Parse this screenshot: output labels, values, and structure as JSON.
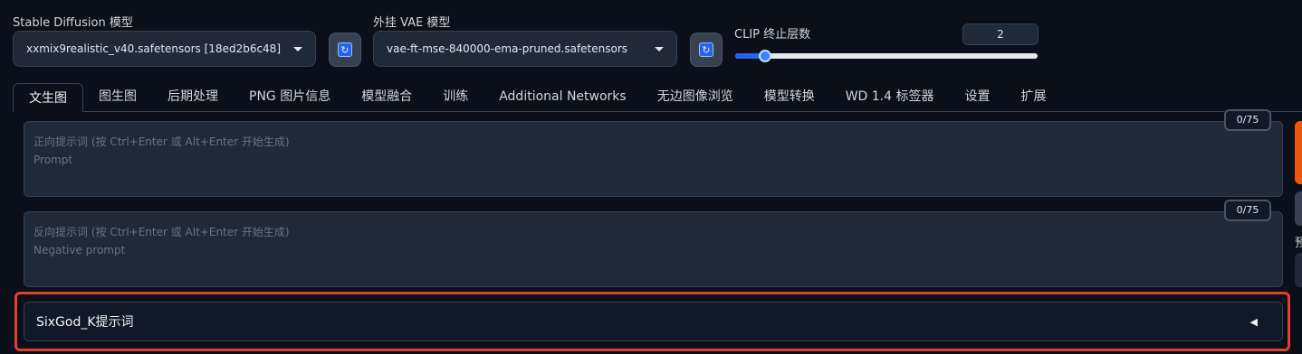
{
  "models": {
    "sd_label": "Stable Diffusion 模型",
    "sd_value": "xxmix9realistic_v40.safetensors [18ed2b6c48]",
    "vae_label": "外挂 VAE 模型",
    "vae_value": "vae-ft-mse-840000-ema-pruned.safetensors"
  },
  "clip": {
    "label": "CLIP 终止层数",
    "value": "2",
    "slider_fraction": 0.1
  },
  "tabs": [
    {
      "label": "文生图",
      "active": true
    },
    {
      "label": "图生图"
    },
    {
      "label": "后期处理"
    },
    {
      "label": "PNG 图片信息"
    },
    {
      "label": "模型融合"
    },
    {
      "label": "训练"
    },
    {
      "label": "Additional Networks"
    },
    {
      "label": "无边图像浏览"
    },
    {
      "label": "模型转换"
    },
    {
      "label": "WD 1.4 标签器"
    },
    {
      "label": "设置"
    },
    {
      "label": "扩展"
    }
  ],
  "prompt": {
    "placeholder_line1": "正向提示词 (按 Ctrl+Enter 或 Alt+Enter 开始生成)",
    "placeholder_line2": "Prompt",
    "counter": "0/75"
  },
  "negative_prompt": {
    "placeholder_line1": "反向提示词 (按 Ctrl+Enter 或 Alt+Enter 开始生成)",
    "placeholder_line2": "Negative prompt",
    "counter": "0/75"
  },
  "accordion": {
    "label": "SixGod_K提示词",
    "toggle": "◀"
  },
  "right_panel": {
    "partial_char": "预"
  },
  "colors": {
    "background": "#0b0f19",
    "accent_blue": "#2563eb",
    "highlight_red": "#e53e2e",
    "generate_orange": "#ea580c"
  }
}
